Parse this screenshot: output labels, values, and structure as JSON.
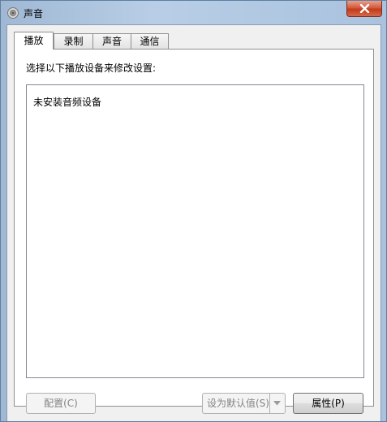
{
  "window": {
    "title": "声音",
    "close_icon": "close-icon",
    "app_icon": "speaker-icon"
  },
  "tabs": [
    {
      "label": "播放",
      "active": true
    },
    {
      "label": "录制",
      "active": false
    },
    {
      "label": "声音",
      "active": false
    },
    {
      "label": "通信",
      "active": false
    }
  ],
  "playback": {
    "instruction": "选择以下播放设备来修改设置:",
    "empty_message": "未安装音频设备"
  },
  "buttons": {
    "configure": "配置(C)",
    "set_default": "设为默认值(S)",
    "properties": "属性(P)"
  }
}
